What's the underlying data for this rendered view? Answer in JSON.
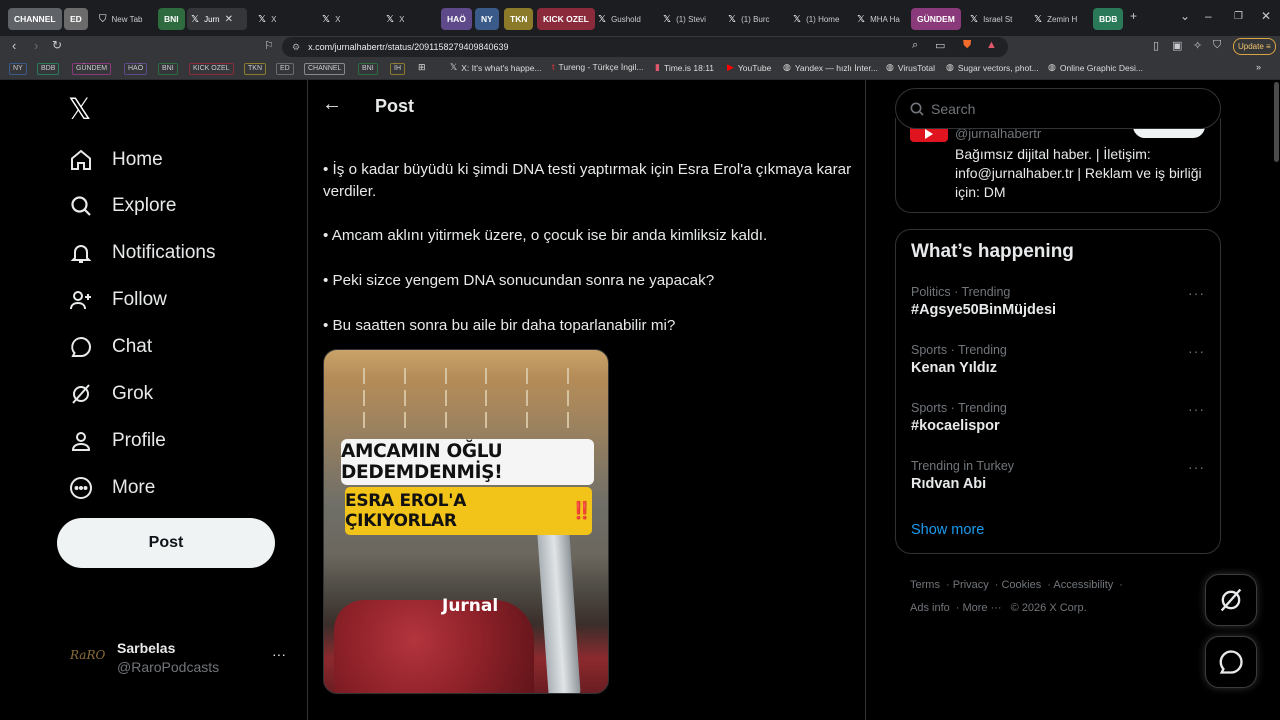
{
  "browser": {
    "tabs": [
      {
        "label": "CHANNEL",
        "type": "group",
        "color": "#5f6368",
        "active": false
      },
      {
        "label": "ED",
        "type": "group",
        "color": "#6b6b6b",
        "active": false
      },
      {
        "label": "New Tab",
        "type": "tab",
        "icon": "shield-icon",
        "active": false
      },
      {
        "label": "BNI",
        "type": "group",
        "color": "#2e6b3f",
        "active": false
      },
      {
        "label": "Jurn",
        "type": "tab",
        "icon": "x-icon",
        "active": true
      },
      {
        "label": "X",
        "type": "tab",
        "icon": "x-icon",
        "active": false
      },
      {
        "label": "X",
        "type": "tab",
        "icon": "x-icon",
        "active": false
      },
      {
        "label": "X",
        "type": "tab",
        "icon": "x-icon",
        "active": false
      },
      {
        "label": "HAÖ",
        "type": "group",
        "color": "#5e4a8a",
        "active": false
      },
      {
        "label": "NY",
        "type": "group",
        "color": "#3a5a8a",
        "active": false
      },
      {
        "label": "TKN",
        "type": "group",
        "color": "#8a7a2a",
        "active": false
      },
      {
        "label": "KICK OZEL",
        "type": "group",
        "color": "#8a2a3a",
        "active": false
      },
      {
        "label": "Gushold",
        "type": "tab",
        "icon": "x-icon",
        "active": false
      },
      {
        "label": "(1) Stevi",
        "type": "tab",
        "icon": "x-icon",
        "active": false
      },
      {
        "label": "(1) Burc",
        "type": "tab",
        "icon": "x-icon",
        "active": false
      },
      {
        "label": "(1) Home",
        "type": "tab",
        "icon": "x-icon",
        "active": false
      },
      {
        "label": "MHA Ha",
        "type": "tab",
        "icon": "x-icon",
        "active": false
      },
      {
        "label": "GÜNDEM",
        "type": "group",
        "color": "#8a3a7a",
        "active": false
      },
      {
        "label": "Israel St",
        "type": "tab",
        "icon": "x-icon",
        "active": false
      },
      {
        "label": "Zemin H",
        "type": "tab",
        "icon": "x-icon",
        "active": false
      },
      {
        "label": "BDB",
        "type": "group",
        "color": "#2a7a5a",
        "active": false
      }
    ],
    "url": "x.com/jurnalhabertr/status/2091158279409840639",
    "update_label": "Update",
    "bookmark_groups": [
      {
        "label": "NY",
        "color": "#3a5a8a"
      },
      {
        "label": "BDB",
        "color": "#2a7a5a"
      },
      {
        "label": "GÜNDEM",
        "color": "#8a3a7a"
      },
      {
        "label": "HAÖ",
        "color": "#5e4a8a"
      },
      {
        "label": "BNI",
        "color": "#2e6b3f"
      },
      {
        "label": "KICK OZEL",
        "color": "#8a2a3a"
      },
      {
        "label": "TKN",
        "color": "#8a7a2a"
      },
      {
        "label": "ED",
        "color": "#6b6b6b"
      },
      {
        "label": "CHANNEL",
        "color": "#5f6368"
      },
      {
        "label": "BNI",
        "color": "#2e6b3f"
      },
      {
        "label": "İH",
        "color": "#8a7a2a"
      }
    ],
    "bookmarks": [
      {
        "label": "X: It's what's happe...",
        "icon": "x-icon"
      },
      {
        "label": "Tureng - Türkçe İngil...",
        "icon": "tureng-icon"
      },
      {
        "label": "Time.is 18:11",
        "icon": "clock-icon"
      },
      {
        "label": "YouTube",
        "icon": "youtube-icon"
      },
      {
        "label": "Yandex — hızlı İnter...",
        "icon": "globe-icon"
      },
      {
        "label": "VirusTotal",
        "icon": "globe-icon"
      },
      {
        "label": "Sugar vectors, phot...",
        "icon": "globe-icon"
      },
      {
        "label": "Online Graphic Desi...",
        "icon": "globe-icon"
      }
    ]
  },
  "sidebar": {
    "items": [
      {
        "label": "Home",
        "icon": "home-icon"
      },
      {
        "label": "Explore",
        "icon": "search-icon"
      },
      {
        "label": "Notifications",
        "icon": "bell-icon"
      },
      {
        "label": "Follow",
        "icon": "follow-icon"
      },
      {
        "label": "Chat",
        "icon": "chat-icon"
      },
      {
        "label": "Grok",
        "icon": "grok-icon"
      },
      {
        "label": "Profile",
        "icon": "profile-icon"
      },
      {
        "label": "More",
        "icon": "more-icon"
      }
    ],
    "post_label": "Post",
    "account": {
      "name": "Sarbelas",
      "handle": "@RaroPodcasts",
      "avatar_text": "RaRO"
    }
  },
  "main": {
    "title": "Post",
    "paragraphs": [
      "• İş o kadar büyüdü ki şimdi DNA testi yaptırmak için Esra Erol'a çıkmaya karar verdiler.",
      "• Amcam aklını yitirmek üzere, o çocuk ise bir anda kimliksiz kaldı.",
      "• Peki sizce yengem DNA sonucundan sonra ne yapacak?",
      "• Bu saatten sonra bu aile bir daha toparlanabilir mi?"
    ],
    "media": {
      "caption1": "AMCAMIN OĞLU DEDEMDENMİŞ!",
      "caption2": "ESRA EROL'A ÇIKIYORLAR",
      "caption2_mark": "‼️",
      "watermark": "Jurnal"
    }
  },
  "right": {
    "search_placeholder": "Search",
    "profile_card": {
      "handle": "@jurnalhabertr",
      "bio": "Bağımsız dijital haber. | İletişim: info@jurnalhaber.tr | Reklam ve iş birliği için: DM"
    },
    "trends_title": "What’s happening",
    "trends": [
      {
        "context": "Politics · Trending",
        "name": "#Agsye50BinMüjdesi"
      },
      {
        "context": "Sports · Trending",
        "name": "Kenan Yıldız"
      },
      {
        "context": "Sports · Trending",
        "name": "#kocaelispor"
      },
      {
        "context": "Trending in Turkey",
        "name": "Rıdvan Abi"
      }
    ],
    "show_more": "Show more",
    "footer": {
      "terms": "Terms",
      "privacy": "Privacy",
      "cookies": "Cookies",
      "accessibility": "Accessibility",
      "ads": "Ads info",
      "more": "More ···",
      "copyright": "© 2026 X Corp."
    }
  }
}
